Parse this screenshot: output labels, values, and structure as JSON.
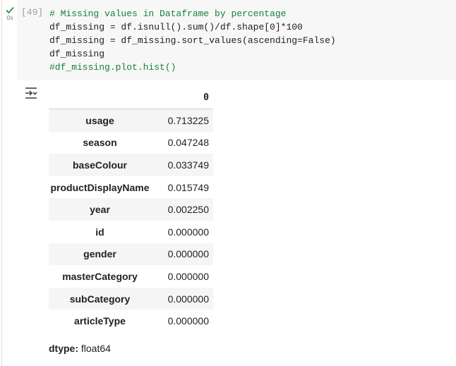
{
  "cell": {
    "status_icon": "check-icon",
    "exec_time": "0s",
    "exec_count": "[49]",
    "code_lines": [
      "# Missing values in Dataframe by percentage",
      "df_missing = df.isnull().sum()/df.shape[0]*100",
      "df_missing = df_missing.sort_values(ascending=False)",
      "df_missing",
      "#df_missing.plot.hist()"
    ]
  },
  "output": {
    "icon": "output-toggle-icon",
    "column_header": "0",
    "rows": [
      {
        "label": "usage",
        "value": "0.713225"
      },
      {
        "label": "season",
        "value": "0.047248"
      },
      {
        "label": "baseColour",
        "value": "0.033749"
      },
      {
        "label": "productDisplayName",
        "value": "0.015749"
      },
      {
        "label": "year",
        "value": "0.002250"
      },
      {
        "label": "id",
        "value": "0.000000"
      },
      {
        "label": "gender",
        "value": "0.000000"
      },
      {
        "label": "masterCategory",
        "value": "0.000000"
      },
      {
        "label": "subCategory",
        "value": "0.000000"
      },
      {
        "label": "articleType",
        "value": "0.000000"
      }
    ],
    "dtype_label": "dtype:",
    "dtype_value": "float64"
  },
  "colors": {
    "code_background": "#f7f7f7",
    "comment": "#188038",
    "success_check": "#188038",
    "row_stripe": "#f5f5f5"
  }
}
